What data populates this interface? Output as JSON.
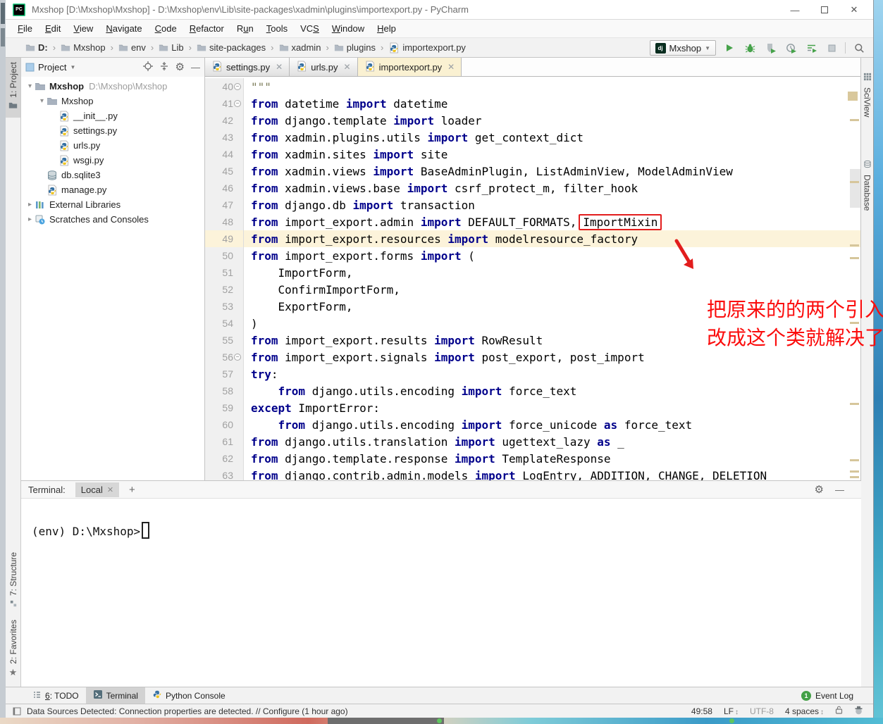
{
  "colors": {
    "accent_green": "#46a24a",
    "annotation_red": "#e21d1d",
    "keyword_blue": "#00008b",
    "current_line_bg": "#fcf3da",
    "active_tab_bg": "#faf1d2"
  },
  "window": {
    "title": "Mxshop [D:\\Mxshop\\Mxshop] - D:\\Mxshop\\env\\Lib\\site-packages\\xadmin\\plugins\\importexport.py - PyCharm"
  },
  "menu": {
    "items": [
      {
        "label": "File",
        "u": 0
      },
      {
        "label": "Edit",
        "u": 0
      },
      {
        "label": "View",
        "u": 0
      },
      {
        "label": "Navigate",
        "u": 0
      },
      {
        "label": "Code",
        "u": 0
      },
      {
        "label": "Refactor",
        "u": 0
      },
      {
        "label": "Run",
        "u": 1
      },
      {
        "label": "Tools",
        "u": 0
      },
      {
        "label": "VCS",
        "u": 2
      },
      {
        "label": "Window",
        "u": 0
      },
      {
        "label": "Help",
        "u": 0
      }
    ]
  },
  "navbar": {
    "crumbs": [
      "D:",
      "Mxshop",
      "env",
      "Lib",
      "site-packages",
      "xadmin",
      "plugins"
    ],
    "file": "importexport.py"
  },
  "run": {
    "badge": "dj",
    "config": "Mxshop"
  },
  "project": {
    "title": "Project",
    "tree": [
      {
        "label": "Mxshop",
        "sub": "D:\\Mxshop\\Mxshop",
        "icon": "folder",
        "lvl": 0,
        "chev": "open",
        "bold": true
      },
      {
        "label": "Mxshop",
        "icon": "folder",
        "lvl": 1,
        "chev": "open"
      },
      {
        "label": "__init__.py",
        "icon": "py",
        "lvl": 2
      },
      {
        "label": "settings.py",
        "icon": "py",
        "lvl": 2
      },
      {
        "label": "urls.py",
        "icon": "py",
        "lvl": 2
      },
      {
        "label": "wsgi.py",
        "icon": "py",
        "lvl": 2
      },
      {
        "label": "db.sqlite3",
        "icon": "db",
        "lvl": 1
      },
      {
        "label": "manage.py",
        "icon": "py",
        "lvl": 1
      },
      {
        "label": "External Libraries",
        "icon": "lib",
        "lvl": 0,
        "chev": "closed"
      },
      {
        "label": "Scratches and Consoles",
        "icon": "scratch",
        "lvl": 0,
        "chev": "closed"
      }
    ]
  },
  "tabs": [
    {
      "label": "settings.py"
    },
    {
      "label": "urls.py"
    },
    {
      "label": "importexport.py",
      "active": true
    }
  ],
  "editor": {
    "lines": [
      {
        "n": 40,
        "fold": true,
        "tk": [
          [
            "s",
            "\"\"\""
          ]
        ]
      },
      {
        "n": 41,
        "fold": true,
        "tk": [
          [
            "k",
            "from"
          ],
          [
            "t",
            " datetime "
          ],
          [
            "k",
            "import"
          ],
          [
            "t",
            " datetime"
          ]
        ]
      },
      {
        "n": 42,
        "tk": [
          [
            "k",
            "from"
          ],
          [
            "t",
            " django.template "
          ],
          [
            "k",
            "import"
          ],
          [
            "t",
            " loader"
          ]
        ]
      },
      {
        "n": 43,
        "tk": [
          [
            "k",
            "from"
          ],
          [
            "t",
            " xadmin.plugins.utils "
          ],
          [
            "k",
            "import"
          ],
          [
            "t",
            " get_context_dict"
          ]
        ]
      },
      {
        "n": 44,
        "tk": [
          [
            "k",
            "from"
          ],
          [
            "t",
            " xadmin.sites "
          ],
          [
            "k",
            "import"
          ],
          [
            "t",
            " site"
          ]
        ]
      },
      {
        "n": 45,
        "tk": [
          [
            "k",
            "from"
          ],
          [
            "t",
            " xadmin.views "
          ],
          [
            "k",
            "import"
          ],
          [
            "t",
            " BaseAdminPlugin, ListAdminView, ModelAdminView"
          ]
        ]
      },
      {
        "n": 46,
        "tk": [
          [
            "k",
            "from"
          ],
          [
            "t",
            " xadmin.views.base "
          ],
          [
            "k",
            "import"
          ],
          [
            "t",
            " csrf_protect_m, filter_hook"
          ]
        ]
      },
      {
        "n": 47,
        "tk": [
          [
            "k",
            "from"
          ],
          [
            "t",
            " django.db "
          ],
          [
            "k",
            "import"
          ],
          [
            "t",
            " transaction"
          ]
        ]
      },
      {
        "n": 48,
        "tk": [
          [
            "k",
            "from"
          ],
          [
            "t",
            " import_export.admin "
          ],
          [
            "k",
            "import"
          ],
          [
            "t",
            " DEFAULT_FORMATS,"
          ],
          [
            "b",
            "ImportMixin"
          ]
        ]
      },
      {
        "n": 49,
        "cur": true,
        "tk": [
          [
            "k",
            "from"
          ],
          [
            "t",
            " import_export.resources "
          ],
          [
            "k",
            "import"
          ],
          [
            "t",
            " modelresource_factory"
          ]
        ]
      },
      {
        "n": 50,
        "tk": [
          [
            "k",
            "from"
          ],
          [
            "t",
            " import_export.forms "
          ],
          [
            "k",
            "import"
          ],
          [
            "t",
            " ("
          ]
        ]
      },
      {
        "n": 51,
        "tk": [
          [
            "t",
            "    ImportForm,"
          ]
        ]
      },
      {
        "n": 52,
        "tk": [
          [
            "t",
            "    ConfirmImportForm,"
          ]
        ]
      },
      {
        "n": 53,
        "tk": [
          [
            "t",
            "    ExportForm,"
          ]
        ]
      },
      {
        "n": 54,
        "tk": [
          [
            "t",
            ")"
          ]
        ]
      },
      {
        "n": 55,
        "tk": [
          [
            "k",
            "from"
          ],
          [
            "t",
            " import_export.results "
          ],
          [
            "k",
            "import"
          ],
          [
            "t",
            " RowResult"
          ]
        ]
      },
      {
        "n": 56,
        "fold": true,
        "tk": [
          [
            "k",
            "from"
          ],
          [
            "t",
            " import_export.signals "
          ],
          [
            "k",
            "import"
          ],
          [
            "t",
            " post_export, post_import"
          ]
        ]
      },
      {
        "n": 57,
        "tk": [
          [
            "k",
            "try"
          ],
          [
            "t",
            ":"
          ]
        ]
      },
      {
        "n": 58,
        "tk": [
          [
            "t",
            "    "
          ],
          [
            "k",
            "from"
          ],
          [
            "t",
            " django.utils.encoding "
          ],
          [
            "k",
            "import"
          ],
          [
            "t",
            " force_text"
          ]
        ]
      },
      {
        "n": 59,
        "tk": [
          [
            "k",
            "except"
          ],
          [
            "t",
            " ImportError:"
          ]
        ]
      },
      {
        "n": 60,
        "tk": [
          [
            "t",
            "    "
          ],
          [
            "k",
            "from"
          ],
          [
            "t",
            " django.utils.encoding "
          ],
          [
            "k",
            "import"
          ],
          [
            "t",
            " force_unicode "
          ],
          [
            "k",
            "as"
          ],
          [
            "t",
            " force_text"
          ]
        ]
      },
      {
        "n": 61,
        "tk": [
          [
            "k",
            "from"
          ],
          [
            "t",
            " django.utils.translation "
          ],
          [
            "k",
            "import"
          ],
          [
            "t",
            " ugettext_lazy "
          ],
          [
            "k",
            "as"
          ],
          [
            "t",
            " _"
          ]
        ]
      },
      {
        "n": 62,
        "tk": [
          [
            "k",
            "from"
          ],
          [
            "t",
            " django.template.response "
          ],
          [
            "k",
            "import"
          ],
          [
            "t",
            " TemplateResponse"
          ]
        ]
      },
      {
        "n": 63,
        "tk": [
          [
            "k",
            "from"
          ],
          [
            "t",
            " django.contrib.admin.models "
          ],
          [
            "k",
            "import"
          ],
          [
            "t",
            " LogEntry, ADDITION, CHANGE, DELETION"
          ]
        ]
      }
    ],
    "note": {
      "line1": "把原来的的两个引入",
      "line2": "改成这个类就解决了"
    }
  },
  "left_stripe": {
    "top": [
      {
        "label": "1: Project",
        "active": true
      }
    ],
    "bottom": [
      {
        "label": "7: Structure"
      },
      {
        "label": "2: Favorites"
      }
    ]
  },
  "right_stripe": {
    "items": [
      {
        "label": "SciView",
        "icon": "grid"
      },
      {
        "label": "Database",
        "icon": "dbgray"
      }
    ]
  },
  "terminal": {
    "label": "Terminal:",
    "tab": "Local",
    "prompt": "(env) D:\\Mxshop>"
  },
  "bottom_bar": {
    "items": [
      {
        "label": "6: TODO",
        "u": 0,
        "icon": "todo"
      },
      {
        "label": "Terminal",
        "icon": "term",
        "active": true
      },
      {
        "label": "Python Console",
        "icon": "pyico"
      }
    ],
    "event_log": "Event Log",
    "event_count": "1"
  },
  "statusbar": {
    "message": "Data Sources Detected: Connection properties are detected. // Configure (1 hour ago)",
    "position": "49:58",
    "line_ending": "LF",
    "encoding": "UTF-8",
    "indent": "4 spaces"
  }
}
